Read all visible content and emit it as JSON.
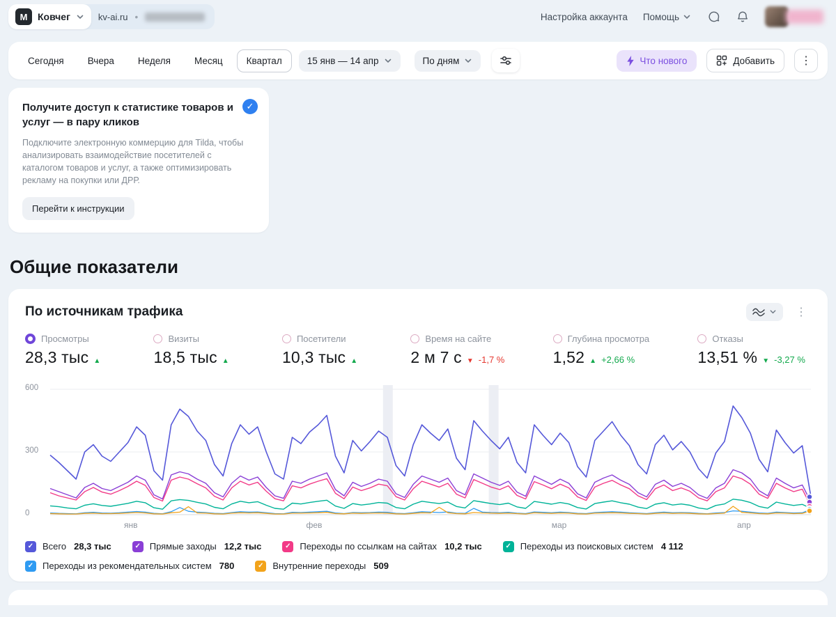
{
  "icons": {
    "check": "✓",
    "dots_vertical": "⋮"
  },
  "header": {
    "logo_text": "M",
    "counter_name": "Ковчег",
    "site": "kv-ai.ru",
    "separator": "•",
    "account_settings": "Настройка аккаунта",
    "help": "Помощь"
  },
  "toolbar": {
    "periods": [
      "Сегодня",
      "Вчера",
      "Неделя",
      "Месяц",
      "Квартал"
    ],
    "date_range": "15 янв — 14 апр",
    "granularity": "По дням",
    "whats_new": "Что нового",
    "add": "Добавить"
  },
  "promo": {
    "title": "Получите доступ к статистике товаров и услуг — в пару кликов",
    "body": "Подключите электронную коммерцию для Tilda, чтобы анализировать взаимодействие посетителей с каталогом товаров и услуг, а также оптимизировать рекламу на покупки или ДРР.",
    "button": "Перейти к инструкции"
  },
  "section_title": "Общие показатели",
  "chart_card": {
    "title": "По источникам трафика",
    "metrics": [
      {
        "label": "Просмотры",
        "value": "28,3 тыс",
        "arrow": "▲",
        "arrow_color": "#13a94d",
        "delta": "",
        "delta_color": ""
      },
      {
        "label": "Визиты",
        "value": "18,5 тыс",
        "arrow": "▲",
        "arrow_color": "#13a94d",
        "delta": "",
        "delta_color": ""
      },
      {
        "label": "Посетители",
        "value": "10,3 тыс",
        "arrow": "▲",
        "arrow_color": "#13a94d",
        "delta": "",
        "delta_color": ""
      },
      {
        "label": "Время на сайте",
        "value": "2 м 7 с",
        "arrow": "▼",
        "arrow_color": "#e5372f",
        "delta": "-1,7 %",
        "delta_color": "#e5372f"
      },
      {
        "label": "Глубина просмотра",
        "value": "1,52",
        "arrow": "▲",
        "arrow_color": "#13a94d",
        "delta": "+2,66 %",
        "delta_color": "#13a94d"
      },
      {
        "label": "Отказы",
        "value": "13,51 %",
        "arrow": "▼",
        "arrow_color": "#13a94d",
        "delta": "-3,27 %",
        "delta_color": "#13a94d"
      }
    ]
  },
  "chart_data": {
    "type": "line",
    "title": "По источникам трафика",
    "x_range": "15 янв — 14 апр, по дням",
    "x_tick_labels": [
      "янв",
      "фев",
      "мар",
      "апр"
    ],
    "x_tick_fractions": [
      0.106,
      0.347,
      0.669,
      0.912
    ],
    "ylim": [
      0,
      600
    ],
    "yticks": [
      0,
      300,
      600
    ],
    "ytick_labels": [
      "600",
      "300",
      "0"
    ],
    "grid": true,
    "legend_position": "bottom",
    "highlight_band_fractions": [
      0.444,
      0.583
    ],
    "series": [
      {
        "name": "Всего",
        "total": "28,3 тыс",
        "color": "#5558d9",
        "width": 1.6,
        "values": [
          285,
          250,
          210,
          170,
          300,
          335,
          280,
          255,
          300,
          345,
          420,
          380,
          210,
          165,
          430,
          505,
          470,
          400,
          355,
          240,
          185,
          340,
          430,
          385,
          420,
          300,
          195,
          170,
          370,
          340,
          395,
          430,
          475,
          280,
          200,
          355,
          305,
          350,
          400,
          370,
          235,
          185,
          335,
          430,
          390,
          355,
          410,
          270,
          215,
          450,
          400,
          355,
          315,
          370,
          250,
          200,
          430,
          380,
          335,
          390,
          345,
          230,
          180,
          355,
          400,
          445,
          380,
          330,
          240,
          195,
          335,
          380,
          310,
          350,
          300,
          220,
          175,
          295,
          350,
          520,
          465,
          390,
          265,
          205,
          405,
          345,
          295,
          330,
          85
        ]
      },
      {
        "name": "Прямые заходы",
        "total": "12,2 тыс",
        "color": "#8a3fd6",
        "width": 1.4,
        "values": [
          125,
          110,
          95,
          80,
          130,
          150,
          125,
          115,
          135,
          155,
          185,
          165,
          95,
          75,
          190,
          205,
          195,
          170,
          150,
          105,
          85,
          150,
          185,
          165,
          180,
          130,
          90,
          78,
          160,
          150,
          170,
          185,
          200,
          120,
          90,
          155,
          135,
          150,
          170,
          160,
          100,
          82,
          145,
          185,
          170,
          155,
          175,
          115,
          95,
          195,
          175,
          155,
          140,
          160,
          108,
          88,
          185,
          165,
          145,
          170,
          150,
          100,
          80,
          155,
          175,
          190,
          165,
          145,
          105,
          85,
          145,
          165,
          135,
          150,
          130,
          95,
          78,
          128,
          150,
          215,
          200,
          170,
          115,
          90,
          175,
          150,
          128,
          142,
          60
        ]
      },
      {
        "name": "Переходы по ссылкам на сайтах",
        "total": "10,2 тыс",
        "color": "#f23a87",
        "width": 1.4,
        "values": [
          105,
          90,
          80,
          70,
          110,
          130,
          108,
          98,
          115,
          135,
          160,
          140,
          82,
          65,
          165,
          180,
          170,
          148,
          128,
          88,
          70,
          128,
          160,
          142,
          155,
          112,
          76,
          66,
          138,
          128,
          146,
          160,
          172,
          102,
          76,
          132,
          115,
          128,
          146,
          138,
          86,
          70,
          124,
          160,
          146,
          132,
          150,
          98,
          80,
          168,
          150,
          132,
          120,
          138,
          92,
          75,
          158,
          142,
          124,
          146,
          128,
          85,
          68,
          132,
          150,
          164,
          142,
          124,
          90,
          72,
          124,
          142,
          115,
          128,
          112,
          80,
          66,
          110,
          128,
          185,
          172,
          146,
          98,
          78,
          150,
          128,
          110,
          122,
          40
        ]
      },
      {
        "name": "Переходы из поисковых систем",
        "total": "4 112",
        "color": "#00b398",
        "width": 1.4,
        "values": [
          42,
          38,
          32,
          28,
          45,
          52,
          44,
          40,
          47,
          54,
          64,
          57,
          33,
          26,
          66,
          72,
          68,
          59,
          51,
          35,
          28,
          51,
          64,
          57,
          62,
          45,
          30,
          26,
          55,
          51,
          58,
          64,
          69,
          41,
          30,
          53,
          46,
          51,
          58,
          55,
          34,
          28,
          50,
          64,
          58,
          53,
          60,
          39,
          32,
          67,
          60,
          53,
          48,
          55,
          37,
          30,
          63,
          57,
          50,
          58,
          51,
          34,
          27,
          53,
          60,
          66,
          57,
          50,
          36,
          29,
          50,
          57,
          46,
          51,
          45,
          32,
          26,
          44,
          51,
          74,
          69,
          58,
          39,
          31,
          60,
          51,
          44,
          49,
          30
        ]
      },
      {
        "name": "Переходы из рекомендательных систем",
        "total": "780",
        "color": "#2f9bf2",
        "width": 1.3,
        "values": [
          8,
          6,
          5,
          4,
          9,
          11,
          8,
          7,
          9,
          12,
          15,
          12,
          6,
          4,
          14,
          34,
          16,
          12,
          10,
          6,
          5,
          10,
          14,
          12,
          13,
          9,
          5,
          4,
          11,
          10,
          12,
          14,
          16,
          8,
          5,
          10,
          9,
          10,
          12,
          11,
          6,
          5,
          9,
          14,
          12,
          10,
          13,
          7,
          6,
          30,
          12,
          10,
          9,
          11,
          7,
          5,
          13,
          11,
          9,
          12,
          10,
          6,
          5,
          10,
          12,
          14,
          12,
          9,
          7,
          5,
          9,
          12,
          9,
          10,
          9,
          6,
          4,
          8,
          10,
          18,
          16,
          12,
          8,
          6,
          12,
          10,
          8,
          9,
          25
        ]
      },
      {
        "name": "Внутренние переходы",
        "total": "509",
        "color": "#f2a31b",
        "width": 1.3,
        "values": [
          5,
          4,
          3,
          3,
          6,
          7,
          5,
          5,
          6,
          8,
          10,
          8,
          4,
          3,
          9,
          12,
          38,
          8,
          7,
          4,
          3,
          7,
          9,
          8,
          9,
          6,
          3,
          3,
          7,
          7,
          8,
          9,
          11,
          5,
          4,
          7,
          6,
          7,
          8,
          7,
          4,
          3,
          6,
          9,
          8,
          35,
          9,
          5,
          4,
          10,
          8,
          7,
          6,
          7,
          5,
          3,
          9,
          7,
          6,
          8,
          7,
          4,
          3,
          7,
          8,
          9,
          8,
          6,
          5,
          3,
          6,
          8,
          6,
          7,
          6,
          4,
          3,
          5,
          7,
          40,
          11,
          8,
          5,
          4,
          8,
          7,
          5,
          6,
          18
        ]
      }
    ]
  }
}
